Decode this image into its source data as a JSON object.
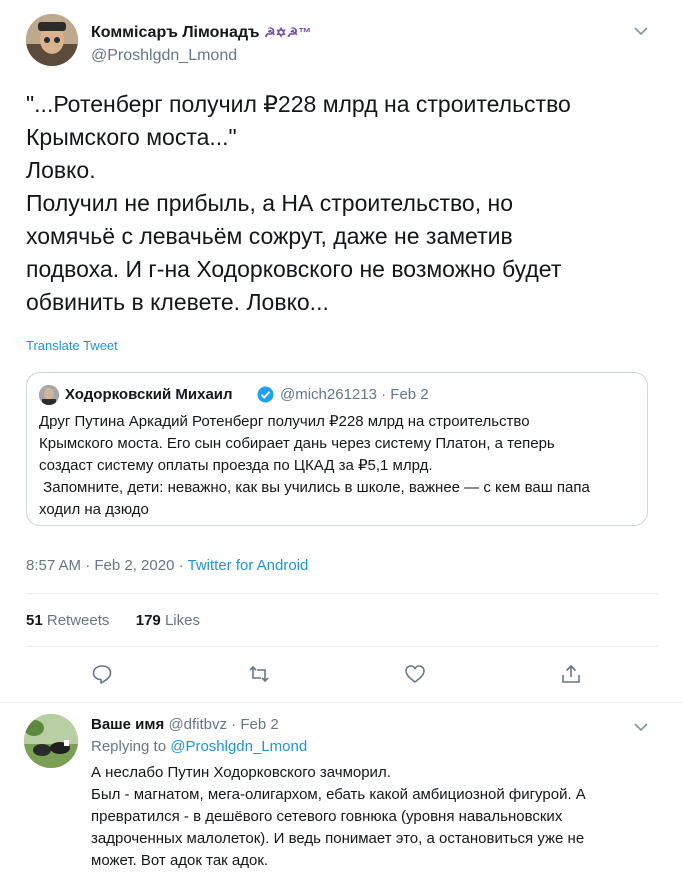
{
  "main_tweet": {
    "name": "Коммісаръ Лімонадъ",
    "name_emoji": "☭✡☭™",
    "handle": "@Proshlgdn_Lmond",
    "text_lines": [
      "\"...Ротенберг получил ₽228 млрд на строительство",
      "Крымского моста...\"",
      "Ловко.",
      "Получил не прибыль, а НА строительство, но",
      "хомячьё с левачьём сожрут, даже не заметив",
      "подвоха. И г-на Ходорковского не возможно будет",
      "обвинить в клевете. Ловко..."
    ],
    "translate_label": "Translate Tweet",
    "time": "8:57 AM · Feb 2, 2020 · ",
    "source": "Twitter for Android",
    "retweets_count": "51",
    "retweets_label": "Retweets",
    "likes_count": "179",
    "likes_label": "Likes"
  },
  "quoted_tweet": {
    "name": "Ходорковский Михаил",
    "handle_date": "@mich261213 · Feb 2",
    "text_lines": [
      "Друг Путина Аркадий Ротенберг получил ₽228 млрд на строительство",
      "Крымского моста. Его сын собирает дань через систему Платон, а теперь",
      "создаст систему оплаты проезда по ЦКАД за ₽5,1 млрд.",
      " Запомните, дети: неважно, как вы учились в школе, важнее — с кем ваш папа",
      "ходил на дзюдо"
    ]
  },
  "reply": {
    "name": "Ваше имя",
    "handle_date": "@dfitbvz · Feb 2",
    "replying_prefix": "Replying to ",
    "replying_handle": "@Proshlgdn_Lmond",
    "text_lines": [
      "А неслабо Путин Ходорковского зачморил.",
      "Был - магнатом, мега-олигархом, ебать какой амбициозной фигурой. А",
      "превратился - в дешёвого сетевого говнюка (уровня навальновских",
      "задроченных малолеток). И ведь понимает это, а остановиться уже не",
      "может. Вот адок так адок."
    ]
  },
  "colors": {
    "accent": "#1b95e0",
    "secondary_text": "#657786",
    "border": "#e6ecf0"
  }
}
